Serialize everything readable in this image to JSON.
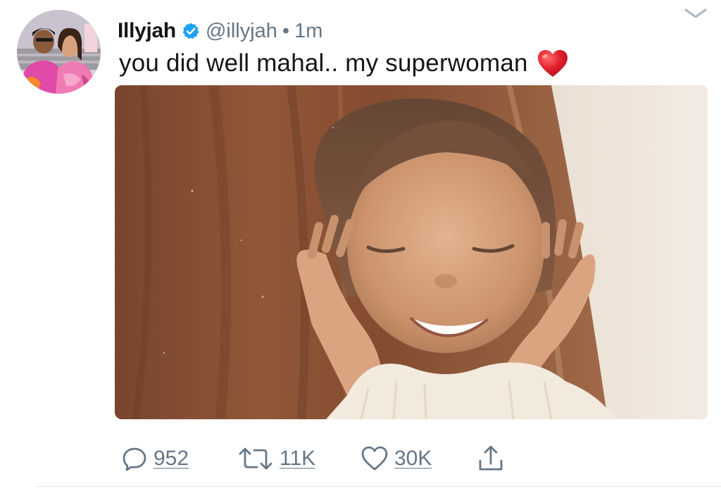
{
  "tweet": {
    "display_name": "Illyjah",
    "handle": "@illyjah",
    "separator": "•",
    "timestamp": "1m",
    "text": "you did well mahal.. my superwoman"
  },
  "actions": {
    "reply_count": "952",
    "retweet_count": "11K",
    "like_count": "30K"
  },
  "icons": {
    "verified": "verified-badge-icon",
    "more": "chevron-down-icon",
    "emoji": "red-heart-emoji",
    "reply": "reply-icon",
    "retweet": "retweet-icon",
    "like": "like-icon",
    "share": "share-icon"
  },
  "colors": {
    "verified_blue": "#1da1f2",
    "secondary_text": "#657786",
    "primary_text": "#14171a",
    "heart_red": "#e0202c"
  }
}
